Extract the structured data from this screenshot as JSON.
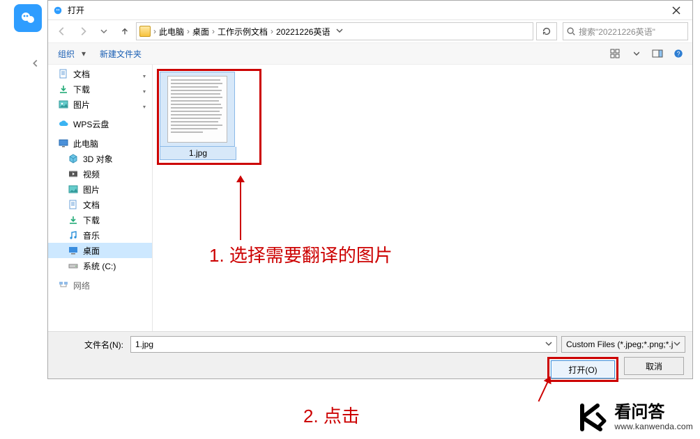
{
  "title": "打开",
  "breadcrumbs": [
    "此电脑",
    "桌面",
    "工作示例文档",
    "20221226英语"
  ],
  "search_placeholder": "搜索\"20221226英语\"",
  "toolbar": {
    "organize": "组织",
    "new_folder": "新建文件夹"
  },
  "tree": [
    {
      "icon": "doc",
      "label": "文档",
      "pinned": true
    },
    {
      "icon": "download",
      "label": "下载",
      "pinned": true
    },
    {
      "icon": "pictures",
      "label": "图片",
      "pinned": true
    },
    {
      "icon": "wps",
      "label": "WPS云盘",
      "group": true
    },
    {
      "icon": "pc",
      "label": "此电脑",
      "group": true
    },
    {
      "icon": "cube",
      "label": "3D 对象",
      "indent": true
    },
    {
      "icon": "video",
      "label": "视频",
      "indent": true
    },
    {
      "icon": "pictures",
      "label": "图片",
      "indent": true
    },
    {
      "icon": "doc",
      "label": "文档",
      "indent": true
    },
    {
      "icon": "download",
      "label": "下载",
      "indent": true
    },
    {
      "icon": "music",
      "label": "音乐",
      "indent": true
    },
    {
      "icon": "desktop",
      "label": "桌面",
      "indent": true,
      "selected": true
    },
    {
      "icon": "drive",
      "label": "系统 (C:)",
      "indent": true
    },
    {
      "icon": "net",
      "label": "网络",
      "group": true
    }
  ],
  "file": {
    "name": "1.jpg"
  },
  "filename_label": "文件名(N):",
  "filename_value": "1.jpg",
  "filter_text": "Custom Files (*.jpeg;*.png;*.j",
  "open_button": "打开(O)",
  "cancel_button": "取消",
  "annotations": {
    "step1": "1. 选择需要翻译的图片",
    "step2": "2. 点击"
  },
  "watermark": {
    "name_cn": "看问答",
    "name_en": "www.kanwenda.com"
  }
}
